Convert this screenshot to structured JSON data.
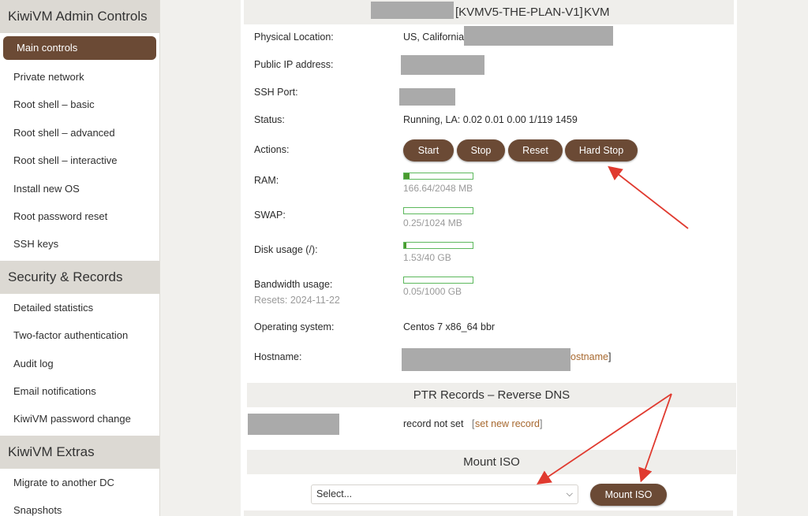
{
  "sidebar": {
    "sections": [
      {
        "title": "KiwiVM Admin Controls",
        "items": [
          {
            "label": "Main controls"
          },
          {
            "label": "Private network"
          },
          {
            "label": "Root shell – basic"
          },
          {
            "label": "Root shell – advanced"
          },
          {
            "label": "Root shell – interactive"
          },
          {
            "label": "Install new OS"
          },
          {
            "label": "Root password reset"
          },
          {
            "label": "SSH keys"
          }
        ]
      },
      {
        "title": "Security & Records",
        "items": [
          {
            "label": "Detailed statistics"
          },
          {
            "label": "Two-factor authentication"
          },
          {
            "label": "Audit log"
          },
          {
            "label": "Email notifications"
          },
          {
            "label": "KiwiVM password change"
          }
        ]
      },
      {
        "title": "KiwiVM Extras",
        "items": [
          {
            "label": "Migrate to another DC"
          },
          {
            "label": "Snapshots"
          }
        ]
      }
    ]
  },
  "server": {
    "header_name": "[KVMV5-THE-PLAN-V1]",
    "header_type": "KVM",
    "location_label": "Physical Location:",
    "location_value": "US, California",
    "ip_label": "Public IP address:",
    "ssh_label": "SSH Port:",
    "status_label": "Status:",
    "status_value": "Running, LA: 0.02 0.01 0.00 1/119 1459",
    "actions_label": "Actions:",
    "actions": {
      "start": "Start",
      "stop": "Stop",
      "reset": "Reset",
      "hard_stop": "Hard Stop"
    },
    "ram_label": "RAM:",
    "ram_text": "166.64/2048 MB",
    "ram_fraction": 0.081,
    "swap_label": "SWAP:",
    "swap_text": "0.25/1024 MB",
    "swap_fraction": 0.0002,
    "disk_label": "Disk usage (/):",
    "disk_text": "1.53/40 GB",
    "disk_fraction": 0.038,
    "bw_label": "Bandwidth usage:",
    "bw_reset": "Resets: 2024-11-22",
    "bw_text": "0.05/1000 GB",
    "bw_fraction": 5e-05,
    "os_label": "Operating system:",
    "os_value": "Centos 7 x86_64 bbr",
    "hostname_label": "Hostname:",
    "hostname_link": "ostname",
    "hostname_bracket": "]"
  },
  "ptr": {
    "title": "PTR Records – Reverse DNS",
    "record_status": "record not set",
    "set_link_open": "[",
    "set_link": "set new record",
    "set_link_close": "]"
  },
  "iso": {
    "title": "Mount ISO",
    "select_value": "Select...",
    "mount_button": "Mount ISO"
  },
  "colors": {
    "accent": "#6b4a35",
    "bar_border": "#5cb85c",
    "bar_fill": "#4a9a2f",
    "link": "#a7682f",
    "annotation_arrow": "#e03a2f"
  }
}
